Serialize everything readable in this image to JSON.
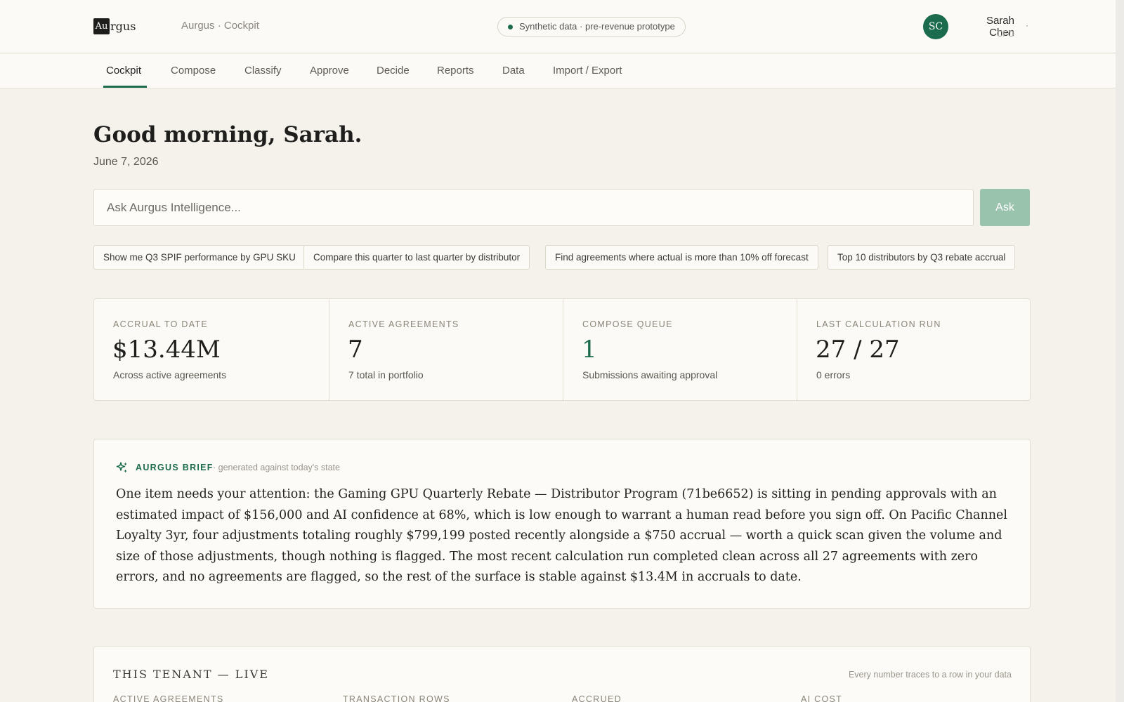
{
  "header": {
    "logo_box": "Au",
    "logo_rest": "rgus",
    "crumb": "Aurgus · Cockpit",
    "env_badge": "Synthetic data · pre-revenue prototype",
    "user": {
      "initials": "SC",
      "name": "Sarah Chen",
      "role": "CFO",
      "caret": "·"
    }
  },
  "tabs": [
    {
      "label": "Cockpit",
      "active": true
    },
    {
      "label": "Compose"
    },
    {
      "label": "Classify"
    },
    {
      "label": "Approve"
    },
    {
      "label": "Decide"
    },
    {
      "label": "Reports"
    },
    {
      "label": "Data"
    },
    {
      "label": "Import / Export"
    }
  ],
  "greeting": "Good morning, Sarah.",
  "date": "June 7, 2026",
  "ask": {
    "placeholder": "Ask Aurgus Intelligence...",
    "button": "Ask"
  },
  "suggestions": [
    "Show me Q3 SPIF performance by GPU SKU",
    "Compare this quarter to last quarter by distributor",
    "Find agreements where actual is more than 10% off forecast",
    "Top 10 distributors by Q3 rebate accrual"
  ],
  "kpis": [
    {
      "label": "ACCRUAL TO DATE",
      "value": "$13.44M",
      "sub": "Across active agreements"
    },
    {
      "label": "ACTIVE AGREEMENTS",
      "value": "7",
      "sub": "7 total in portfolio"
    },
    {
      "label": "COMPOSE QUEUE",
      "value": "1",
      "sub": "Submissions awaiting approval"
    },
    {
      "label": "LAST CALCULATION RUN",
      "value": "27 / 27",
      "sub": "0 errors"
    }
  ],
  "brief": {
    "title": "AURGUS BRIEF",
    "meta": "· generated against today's state",
    "body": "One item needs your attention: the Gaming GPU Quarterly Rebate — Distributor Program (71be6652) is sitting in pending approvals with an estimated impact of $156,000 and AI confidence at 68%, which is low enough to warrant a human read before you sign off. On Pacific Channel Loyalty 3yr, four adjustments totaling roughly $799,199 posted recently alongside a $750 accrual — worth a quick scan given the volume and size of those adjustments, though nothing is flagged. The most recent calculation run completed clean across all 27 agreements with zero errors, and no agreements are flagged, so the rest of the surface is stable against $13.4M in accruals to date."
  },
  "tenant": {
    "title": "THIS TENANT — LIVE",
    "note": "Every number traces to a row in your data",
    "columns": [
      "ACTIVE AGREEMENTS",
      "TRANSACTION ROWS",
      "ACCRUED",
      "AI COST"
    ]
  },
  "colors": {
    "accent": "#1b6b4e",
    "ask_button": "#9ac3ae",
    "background": "#f5f2ec"
  }
}
